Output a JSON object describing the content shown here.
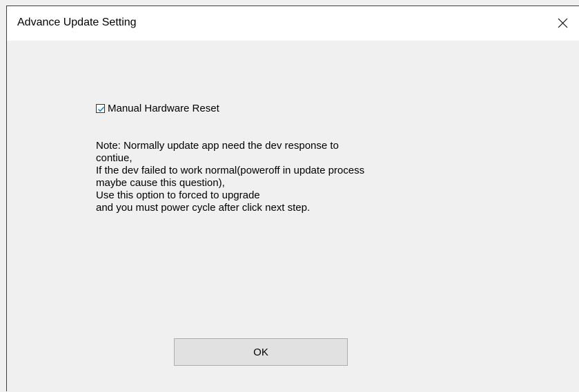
{
  "window": {
    "title": "Advance Update Setting"
  },
  "option": {
    "label": "Manual Hardware Reset",
    "checked": true
  },
  "note": {
    "lines": [
      "Note: Normally update app need the dev response to",
      "contiue,",
      "If the dev failed to work normal(poweroff in update process",
      "maybe cause this question),",
      "Use this option to forced to upgrade",
      "and you must power cycle after click next step."
    ]
  },
  "buttons": {
    "ok_label": "OK"
  },
  "icons": {
    "close": "close-icon",
    "checkmark": "checkmark-icon"
  },
  "colors": {
    "checkbox_accent": "#0078d7",
    "window_bg": "#f0f0f0",
    "titlebar_bg": "#ffffff",
    "button_bg": "#e1e1e1"
  }
}
